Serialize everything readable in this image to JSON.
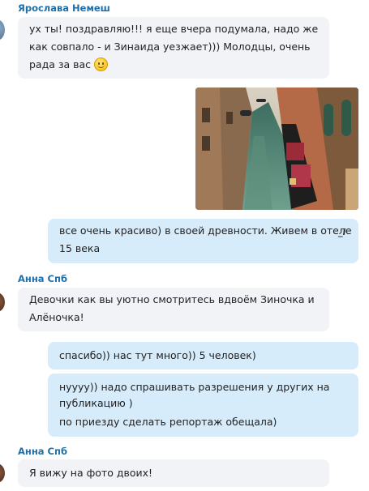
{
  "messages": [
    {
      "sender": "Ярослава Немеш",
      "lines": [
        "ух ты! поздравляю!!! я еще вчера подумала, надо же",
        "как совпало - и Зинаида уезжает))) Молодцы, очень",
        "рада за вас"
      ],
      "emoji": "smile-emoji"
    },
    {
      "photo_alt": "canal-photo"
    },
    {
      "lines": [
        "все очень красиво) в своей древности. Живем в отеле",
        "15 века"
      ],
      "edit_mark": "_i"
    },
    {
      "sender": "Анна Спб",
      "lines": [
        "Девочки как вы уютно смотритесь вдвоём Зиночка и",
        "Алёночка!"
      ]
    },
    {
      "lines": [
        "спасибо)) нас тут много)) 5 человек)"
      ]
    },
    {
      "lines": [
        "нуууу)) надо спрашивать разрешения у других на",
        "публикацию )",
        "по приезду сделать репортаж обещала)"
      ]
    },
    {
      "sender": "Анна Спб",
      "lines": [
        "Я вижу на фото двоих!"
      ]
    }
  ],
  "colors": {
    "sender": "#1f6fa8",
    "incoming_bubble": "#f1f3f6",
    "outgoing_bubble": "#d6ecfb"
  }
}
